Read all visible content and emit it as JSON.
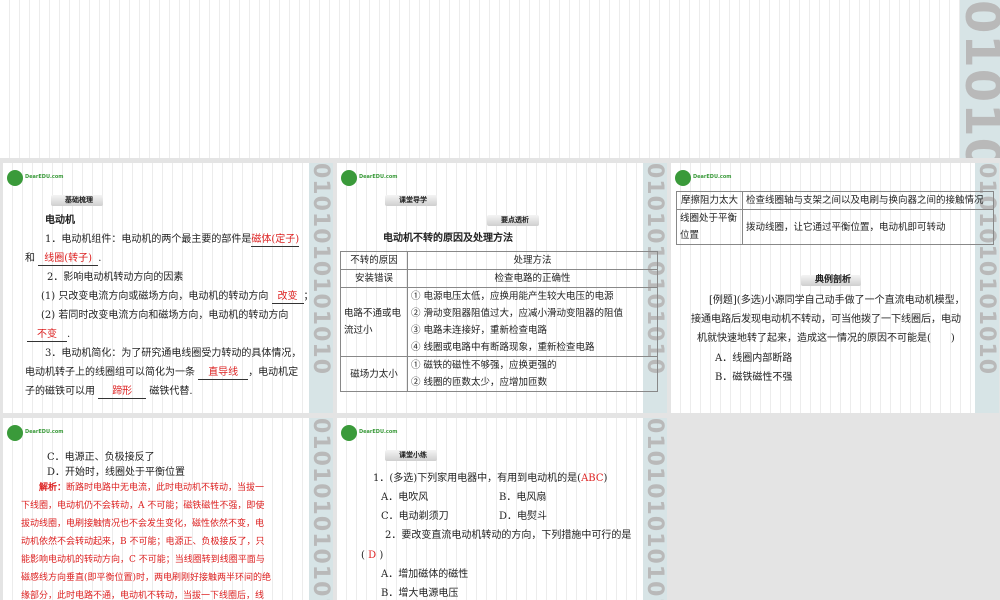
{
  "decor": {
    "binary": "0101010101010"
  },
  "slide1": {
    "logo": "DearEDU.com",
    "tag": "基础梳理",
    "heading": "电动机",
    "l1a": "1．电动机组件：电动机的两个最主要的部件是",
    "l1ans": "磁体(定子)",
    "l1b": "和",
    "l1ans2": "线圈(转子)",
    "l1c": ".",
    "l2": "2．影响电动机转动方向的因素",
    "l3a": "(1) 只改变电流方向或磁场方向，电动机的转动方向",
    "l3ans": "改变",
    "l3b": "；",
    "l4a": "(2) 若同时改变电流方向和磁场方向，电动机的转动方向",
    "l4ans": "不变",
    "l4b": ".",
    "l5": "3．电动机简化：为了研究通电线圈受力转动的具体情况，",
    "l6a": "电动机转子上的线圈组可以简化为一条",
    "l6ans": "直导线",
    "l6b": "，电动机定",
    "l7a": "子的磁铁可以用",
    "l7ans": "蹄形",
    "l7b": "磁铁代替."
  },
  "slide2": {
    "tag": "课堂导学",
    "tag2": "要点透析",
    "heading": "电动机不转的原因及处理方法",
    "head": [
      "不转的原因",
      "处理方法"
    ],
    "r1": [
      "安装错误",
      "检查电路的正确性"
    ],
    "r2c": "电路不通或电流过小",
    "r2": [
      "① 电源电压太低，应换用能产生较大电压的电源",
      "② 滑动变阻器阻值过大，应减小滑动变阻器的阻值",
      "③ 电路未连接好，重新检查电路",
      "④ 线圈或电路中有断路现象，重新检查电路"
    ],
    "r3c": "磁场力太小",
    "r3": [
      "① 磁铁的磁性不够强，应换更强的",
      "② 线圈的匝数太少，应增加匝数"
    ]
  },
  "slide3": {
    "r1": [
      "摩擦阻力太大",
      "检查线圈轴与支架之间以及电刷与换向器之间的接触情况"
    ],
    "r2": [
      "线圈处于平衡位置",
      "拨动线圈，让它通过平衡位置，电动机即可转动"
    ],
    "tag": "典例剖析",
    "q1": "[例题](多选)小源同学自己动手做了一个直流电动机模型，",
    "q2": "接通电路后发现电动机不转动，可当他拨了一下线圈后，电动",
    "q3": "机就快速地转了起来，造成这一情况的原因不可能是(　　)",
    "a": "A．线圈内部断路",
    "b": "B．磁铁磁性不强"
  },
  "slide4": {
    "c": "C．电源正、负极接反了",
    "d": "D．开始时，线圈处于平衡位置",
    "label": "解析：",
    "lines": [
      "断路时电路中无电流，此时电动机不转动，当拔一",
      "下线圈，电动机仍不会转动，A 不可能；磁铁磁性不强，即使",
      "拔动线圈，电刷接触情况也不会发生变化，磁性依然不变，电",
      "动机依然不会转动起来，B 不可能；电源正、负极接反了，只",
      "能影响电动机的转动方向，C 不可能；当线圈转到线圈平面与",
      "磁感线方向垂直(即平衡位置)时，两电刷刚好接触两半环间的绝",
      "缘部分，此时电路不通，电动机不转动，当拔一下线圈后，线"
    ]
  },
  "slide5": {
    "tag": "课堂小练",
    "q1": "1．(多选)下列家用电器中，有用到电动机的是(",
    "q1ans": "ABC",
    "q1end": ")",
    "a": "A．电吹风",
    "b": "B．电风扇",
    "c": "C．电动剃须刀",
    "d": "D．电熨斗",
    "q2": "2．要改变直流电动机转动的方向，下列措施中可行的是",
    "q2open": "(",
    "q2ans": "D",
    "q2close": ")",
    "q2a": "A．增加磁体的磁性",
    "q2b": "B．增大电源电压"
  }
}
